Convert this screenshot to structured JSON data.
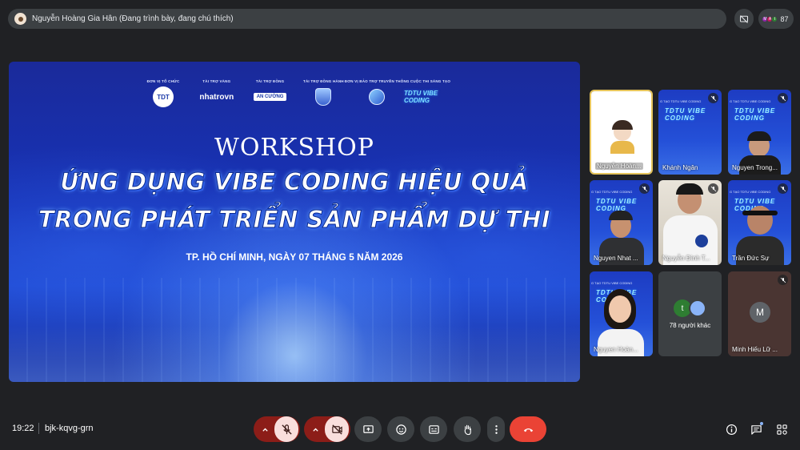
{
  "presenter_bar": {
    "text": "Nguyễn Hoàng Gia Hân (Đang trình bày, đang chú thích)"
  },
  "people_count": "87",
  "slide": {
    "sponsors": [
      {
        "label": "ĐƠN VỊ TỔ CHỨC",
        "logo": "TDT"
      },
      {
        "label": "TÀI TRỢ VÀNG",
        "logo": "nhatrovn"
      },
      {
        "label": "TÀI TRỢ ĐỒNG",
        "logo": "AN CƯỜNG"
      },
      {
        "label": "TÀI TRỢ ĐỒNG HÀNH",
        "logo": ""
      },
      {
        "label": "ĐƠN VỊ BẢO TRỢ TRUYỀN THÔNG",
        "logo": ""
      },
      {
        "label": "CUỘC THI SÁNG TẠO",
        "logo": "TDTU VIBE CODING"
      }
    ],
    "workshop": "WORKSHOP",
    "headline_1": "ỨNG DỤNG VIBE CODING HIỆU QUẢ",
    "headline_2": "TRONG PHÁT TRIỂN SẢN PHẨM DỰ THI",
    "date_line": "TP. HỒ CHÍ MINH, NGÀY 07 THÁNG 5 NĂM 2026"
  },
  "tiles": [
    {
      "name": "Nguyễn Hoàn...",
      "muted": false
    },
    {
      "name": "Khánh Ngân",
      "muted": true
    },
    {
      "name": "Nguyen Trong...",
      "muted": true
    },
    {
      "name": "Nguyen Nhat ...",
      "muted": true
    },
    {
      "name": "Nguyễn Đình T...",
      "muted": true
    },
    {
      "name": "Trần Đức Sự",
      "muted": true
    },
    {
      "name": "Nguyen Hoàn...",
      "muted": false
    },
    {
      "name": "78 người khác",
      "avatar_letter": "t"
    },
    {
      "name": "Minh Hiếu Lữ ...",
      "avatar_letter": "M",
      "muted": true
    }
  ],
  "thumb_text": "G TẠO TDTU VIBE CODING",
  "thumb_logo": "TDTU VIBE CODING",
  "meeting": {
    "time": "19:22",
    "code": "bjk-kqvg-grn"
  },
  "colors": {
    "background": "#202124",
    "control": "#3c4043",
    "end_call": "#ea4335",
    "muted_pink": "#f9dedc",
    "active_border": "#e6c45b"
  }
}
